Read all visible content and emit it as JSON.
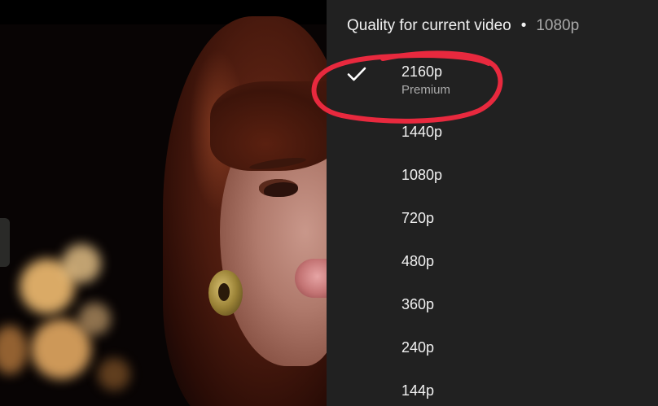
{
  "quality_panel": {
    "title": "Quality for current video",
    "separator": "•",
    "current_value": "1080p",
    "selected_index": 0,
    "options": [
      {
        "label": "2160p",
        "sublabel": "Premium",
        "selected": true
      },
      {
        "label": "1440p",
        "selected": false
      },
      {
        "label": "1080p",
        "selected": false
      },
      {
        "label": "720p",
        "selected": false
      },
      {
        "label": "480p",
        "selected": false
      },
      {
        "label": "360p",
        "selected": false
      },
      {
        "label": "240p",
        "selected": false
      },
      {
        "label": "144p",
        "selected": false
      }
    ]
  },
  "icons": {
    "selected_marker": "checkmark-icon"
  },
  "colors": {
    "panel_background": "#212121",
    "primary_text": "#f1f1f1",
    "secondary_text": "#aaaaaa",
    "annotation_stroke": "#e8293e"
  }
}
